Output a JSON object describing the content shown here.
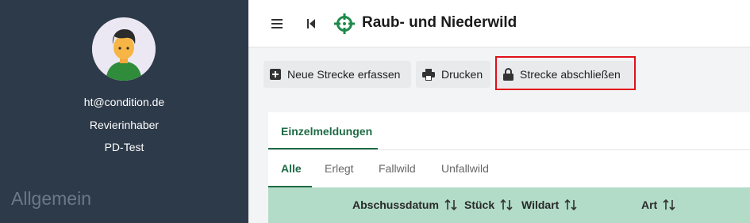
{
  "sidebar": {
    "email": "ht@condition.de",
    "role": "Revierinhaber",
    "org": "PD-Test",
    "section": "Allgemein"
  },
  "header": {
    "title": "Raub- und Niederwild"
  },
  "toolbar": {
    "new_label": "Neue Strecke erfassen",
    "print_label": "Drucken",
    "lock_label": "Strecke abschließen"
  },
  "tabs": {
    "main": "Einzelmeldungen",
    "filters": [
      "Alle",
      "Erlegt",
      "Fallwild",
      "Unfallwild"
    ]
  },
  "table": {
    "columns": [
      "Abschussdatum",
      "Stück",
      "Wildart",
      "Art"
    ]
  },
  "colors": {
    "accent": "#1e6b45",
    "sidebar": "#2d3a4a",
    "table_header": "#b2dcc8",
    "highlight": "#e0101a"
  }
}
